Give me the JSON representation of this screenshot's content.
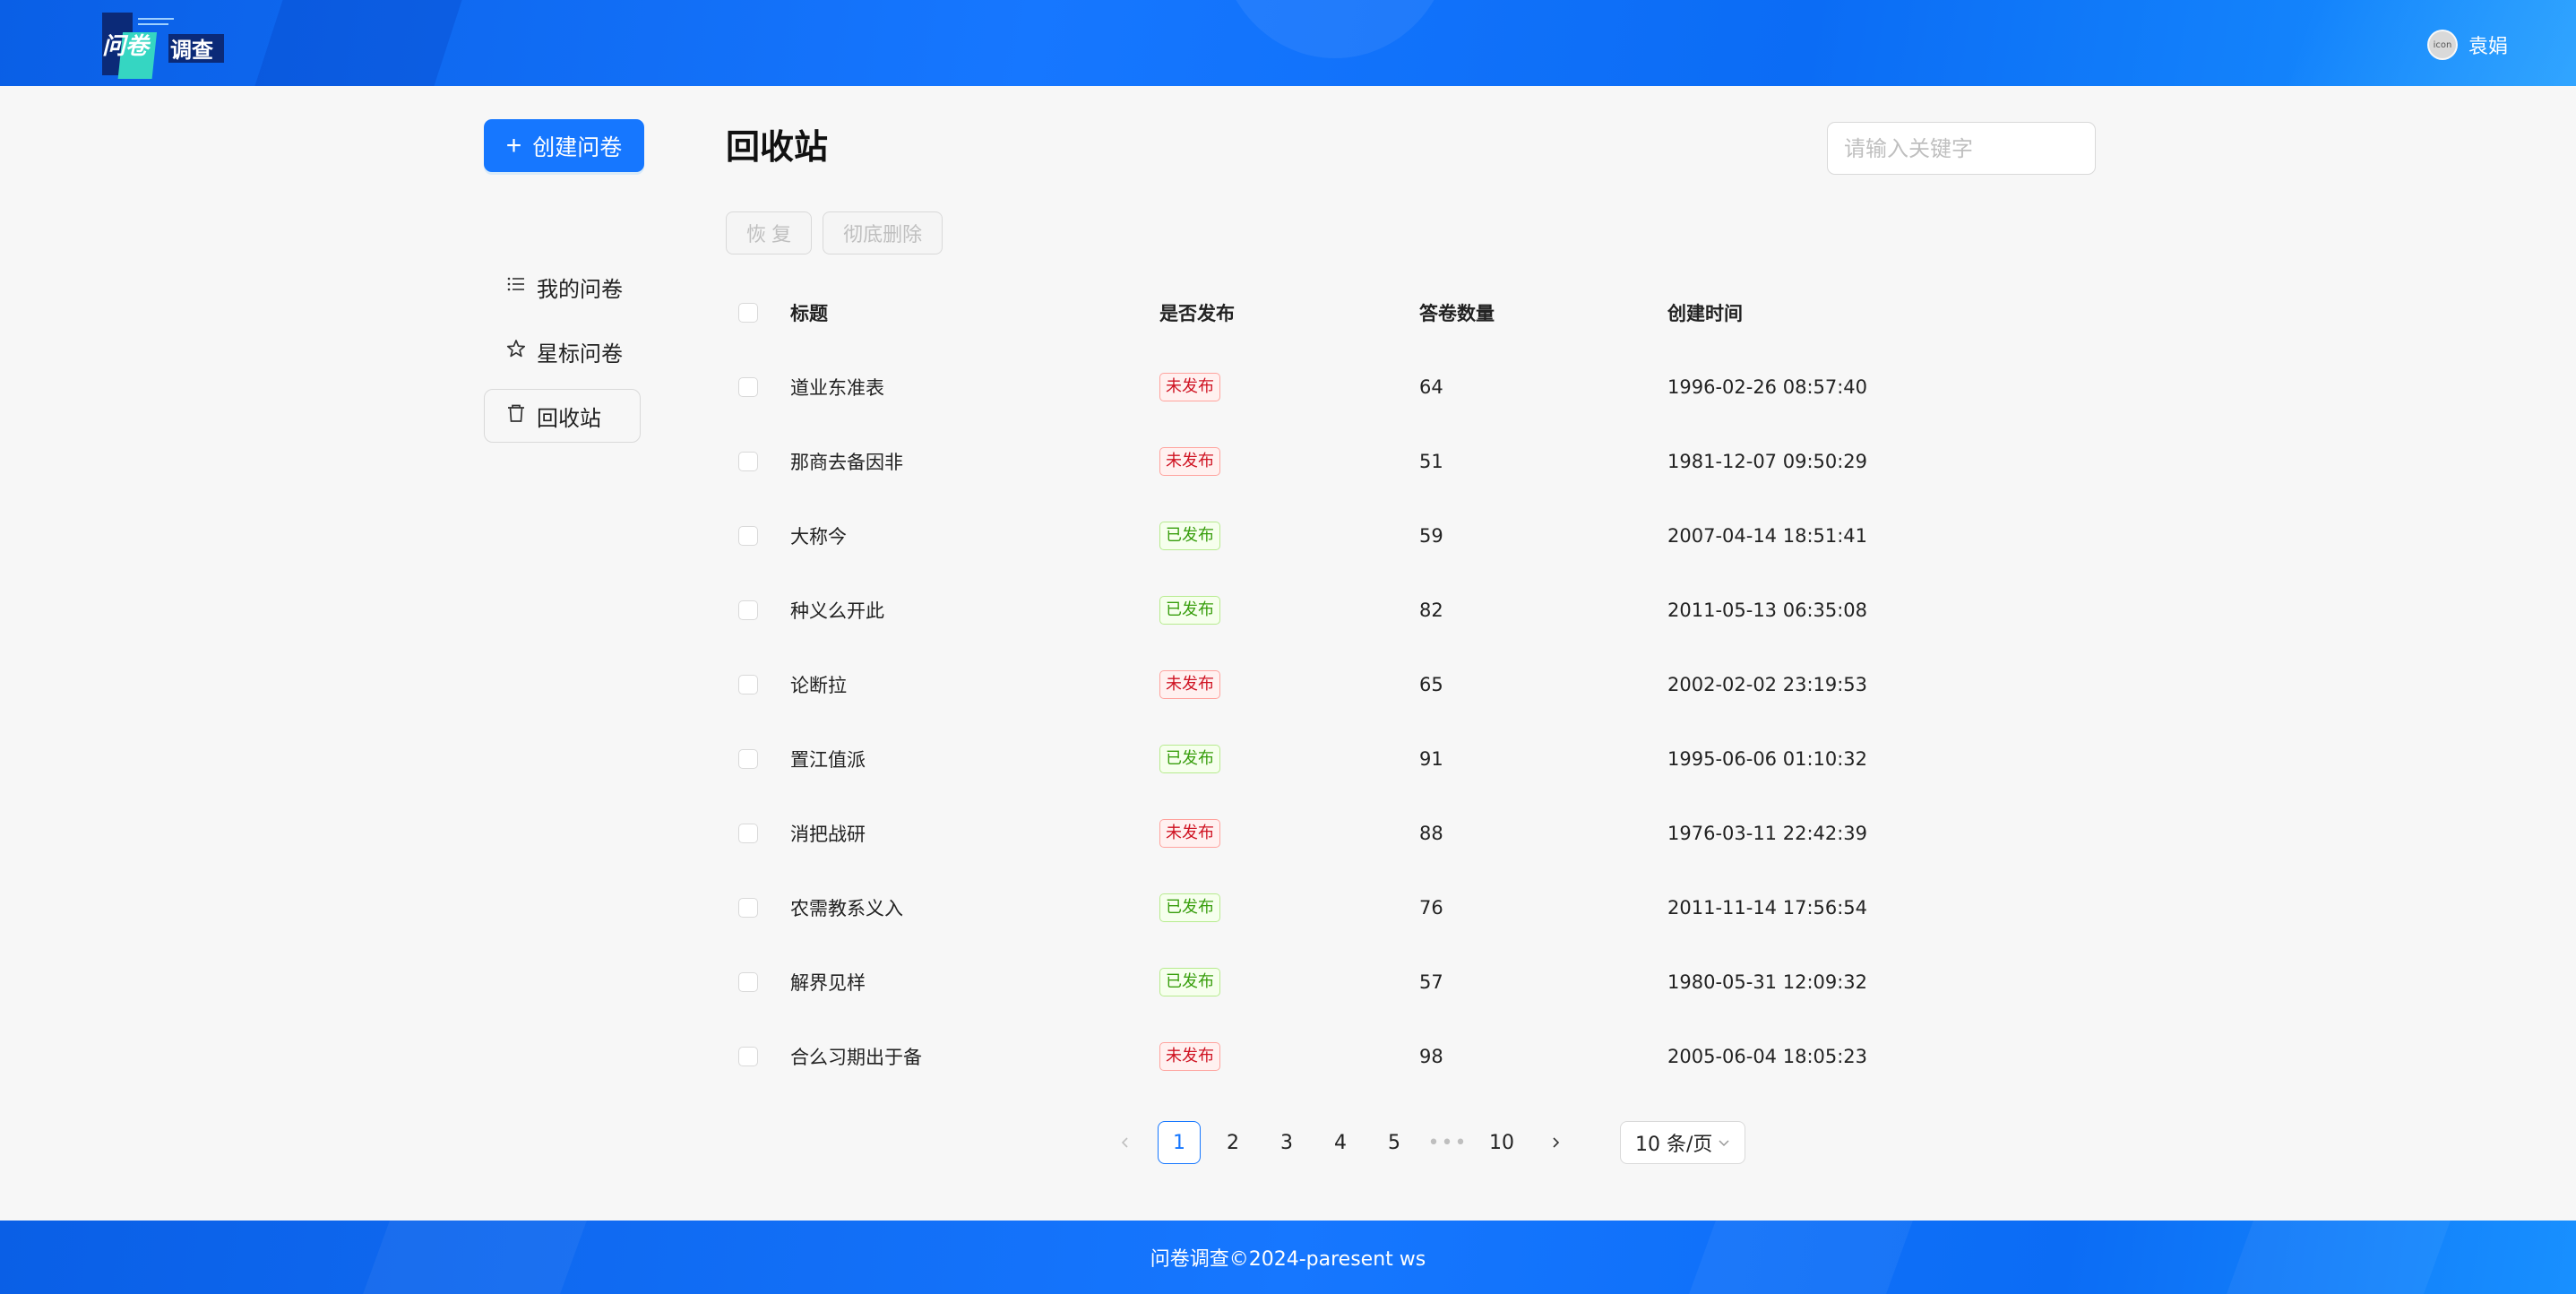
{
  "header": {
    "logo_text": "问卷调查",
    "user": {
      "avatar_text": "icon",
      "name": "袁娟"
    }
  },
  "sidebar": {
    "create_button": "创建问卷",
    "items": [
      {
        "label": "我的问卷",
        "icon": "list-icon",
        "active": false
      },
      {
        "label": "星标问卷",
        "icon": "star-icon",
        "active": false
      },
      {
        "label": "回收站",
        "icon": "trash-icon",
        "active": true
      }
    ]
  },
  "main": {
    "title": "回收站",
    "search": {
      "placeholder": "请输入关键字",
      "value": ""
    },
    "actions": {
      "restore": "恢 复",
      "delete_forever": "彻底删除"
    },
    "table": {
      "headers": [
        "标题",
        "是否发布",
        "答卷数量",
        "创建时间"
      ],
      "rows": [
        {
          "title": "道业东准表",
          "published": "未发布",
          "is_published": false,
          "count": "64",
          "created": "1996-02-26 08:57:40"
        },
        {
          "title": "那商去备因非",
          "published": "未发布",
          "is_published": false,
          "count": "51",
          "created": "1981-12-07 09:50:29"
        },
        {
          "title": "大称今",
          "published": "已发布",
          "is_published": true,
          "count": "59",
          "created": "2007-04-14 18:51:41"
        },
        {
          "title": "种义么开此",
          "published": "已发布",
          "is_published": true,
          "count": "82",
          "created": "2011-05-13 06:35:08"
        },
        {
          "title": "论断拉",
          "published": "未发布",
          "is_published": false,
          "count": "65",
          "created": "2002-02-02 23:19:53"
        },
        {
          "title": "置江值派",
          "published": "已发布",
          "is_published": true,
          "count": "91",
          "created": "1995-06-06 01:10:32"
        },
        {
          "title": "消把战研",
          "published": "未发布",
          "is_published": false,
          "count": "88",
          "created": "1976-03-11 22:42:39"
        },
        {
          "title": "农需教系义入",
          "published": "已发布",
          "is_published": true,
          "count": "76",
          "created": "2011-11-14 17:56:54"
        },
        {
          "title": "解界见样",
          "published": "已发布",
          "is_published": true,
          "count": "57",
          "created": "1980-05-31 12:09:32"
        },
        {
          "title": "合么习期出于备",
          "published": "未发布",
          "is_published": false,
          "count": "98",
          "created": "2005-06-04 18:05:23"
        }
      ]
    },
    "pagination": {
      "pages": [
        "1",
        "2",
        "3",
        "4",
        "5"
      ],
      "current": "1",
      "ellipsis": "•••",
      "last": "10",
      "page_size": "10 条/页"
    }
  },
  "footer": {
    "text": "问卷调查©2024-paresent ws"
  },
  "colors": {
    "primary": "#1677ff",
    "unpublished": "#cf1322",
    "published": "#389e0d"
  }
}
